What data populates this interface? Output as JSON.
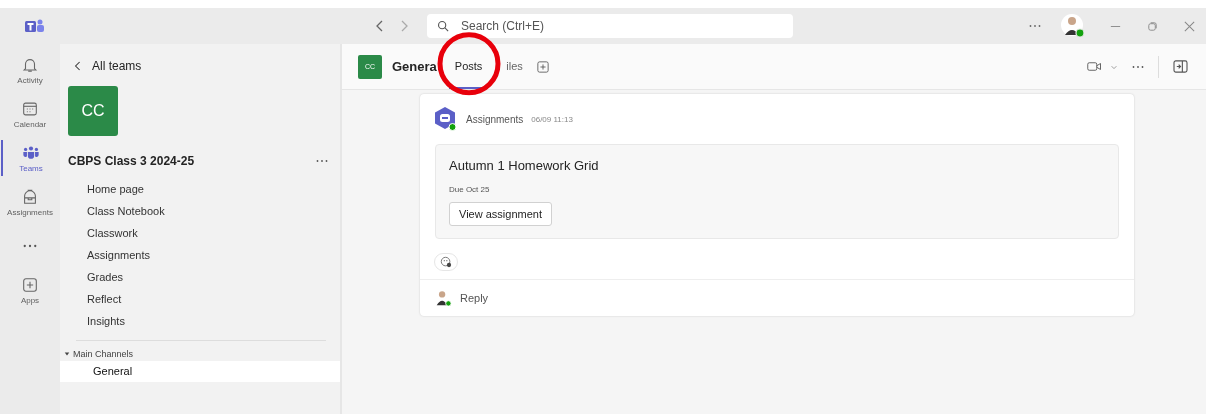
{
  "titlebar": {
    "search": {
      "placeholder": "Search (Ctrl+E)"
    }
  },
  "rail": [
    {
      "label": "Activity",
      "kind": "bell",
      "selected": false
    },
    {
      "label": "Calendar",
      "kind": "calendar",
      "selected": false
    },
    {
      "label": "Teams",
      "kind": "teams",
      "selected": true
    },
    {
      "label": "Assignments",
      "kind": "bag",
      "selected": false
    },
    {
      "kind": "more",
      "selected": false
    },
    {
      "label": "Apps",
      "kind": "apps",
      "selected": false
    }
  ],
  "sidebar": {
    "back": "All teams",
    "team_avatar": "CC",
    "team_name": "CBPS Class 3 2024-25",
    "items": [
      {
        "label": "Home page"
      },
      {
        "label": "Class Notebook"
      },
      {
        "label": "Classwork"
      },
      {
        "label": "Assignments"
      },
      {
        "label": "Grades"
      },
      {
        "label": "Reflect"
      },
      {
        "label": "Insights"
      }
    ],
    "section": "Main Channels",
    "channels": [
      {
        "label": "General",
        "selected": true
      }
    ]
  },
  "header": {
    "avatar": "CC",
    "title": "Genera",
    "tabs": [
      {
        "label": "Posts",
        "selected": true
      },
      {
        "label": "iles",
        "selected": false
      }
    ]
  },
  "post": {
    "author": "Assignments",
    "time": "06/09 11:13",
    "card": {
      "title": "Autumn 1 Homework Grid",
      "due": "Due Oct 25",
      "button": "View assignment"
    },
    "reply": "Reply"
  }
}
